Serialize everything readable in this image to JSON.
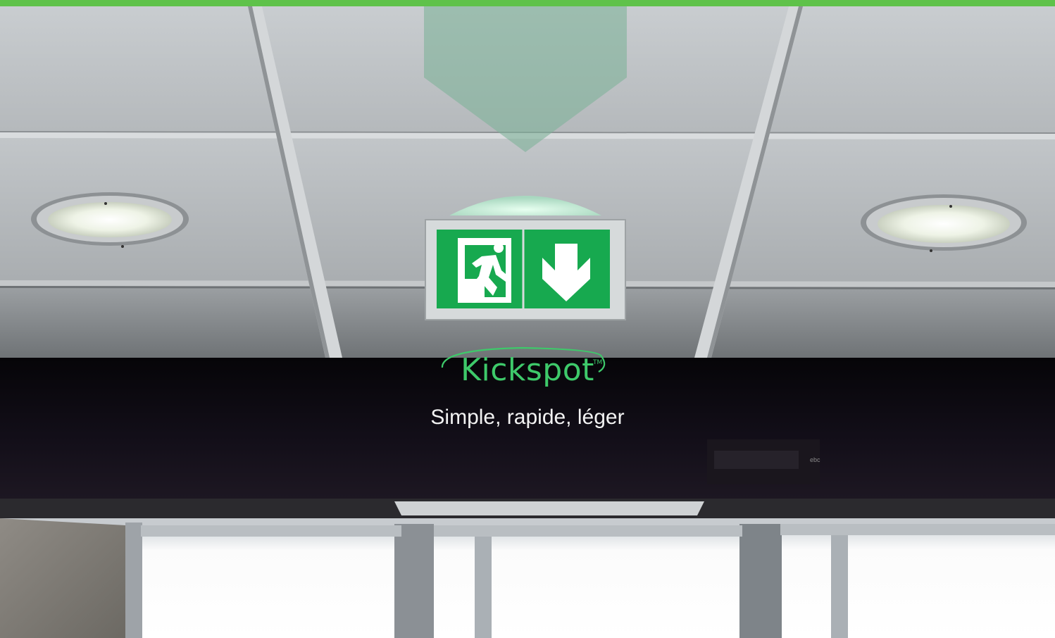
{
  "brand": {
    "name": "Kickspot",
    "trademark": "TM",
    "tagline": "Simple, rapide, léger"
  },
  "fixtures": {
    "small_label": "ebc"
  },
  "colors": {
    "top_border": "#5fc24a",
    "sign_green": "#17a94f",
    "logo_green": "#3ec96a",
    "beam": "#0c0a0f"
  },
  "icons": {
    "exit_sign_left": "running-man-exit-icon",
    "exit_sign_right": "arrow-down-icon",
    "ceiling_arrow": "arrow-down-icon"
  }
}
